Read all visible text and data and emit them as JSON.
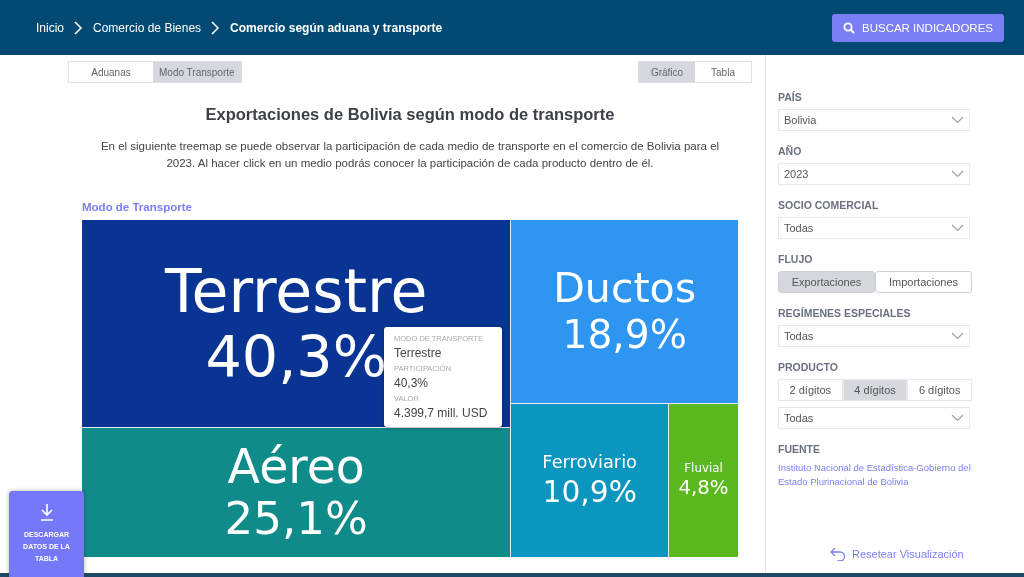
{
  "breadcrumb": [
    {
      "label": "Inicio",
      "current": false
    },
    {
      "label": "Comercio de Bienes",
      "current": false
    },
    {
      "label": "Comercio según aduana y transporte",
      "current": true
    }
  ],
  "search_button": "BUSCAR INDICADORES",
  "view_tabs": [
    {
      "label": "Aduanas",
      "selected": false
    },
    {
      "label": "Modo Transporte",
      "selected": true
    }
  ],
  "chart_tabs": [
    {
      "label": "Gráfico",
      "selected": true
    },
    {
      "label": "Tabla",
      "selected": false
    }
  ],
  "title": "Exportaciones de Bolivia según modo de transporte",
  "description": "En el siguiente treemap se puede observar la participación de cada medio de transporte en el comercio de Bolivia para el 2023. Al hacer click en un medio  podrás conocer la participación de cada producto dentro de él.",
  "treemap": {
    "heading": "Modo de Transporte",
    "columns": [
      {
        "rows": [
          {
            "tiles": [
              {
                "label": "Terrestre",
                "share": "40,3%",
                "color": "#0a3494"
              }
            ]
          },
          {
            "tiles": [
              {
                "label": "Aéreo",
                "share": "25,1%",
                "color": "#0f8b8a"
              }
            ]
          }
        ]
      },
      {
        "rows": [
          {
            "tiles": [
              {
                "label": "Ductos",
                "share": "18,9%",
                "color": "#2e96f0"
              }
            ]
          },
          {
            "tiles": [
              {
                "label": "Ferroviario",
                "share": "10,9%",
                "color": "#0a96be"
              },
              {
                "label": "Fluvial",
                "share": "4,8%",
                "color": "#5cb81f"
              }
            ]
          }
        ]
      }
    ],
    "tooltip": [
      {
        "label": "MODO DE TRANSPORTE",
        "value": "Terrestre"
      },
      {
        "label": "PARTICIPACIÓN",
        "value": "40,3%"
      },
      {
        "label": "VALOR",
        "value": "4.399,7 mill. USD"
      }
    ]
  },
  "download_button": "DESCARGAR DATOS DE LA TABLA",
  "filters": [
    {
      "kind": "select",
      "label": "PAÍS",
      "value": "Bolivia"
    },
    {
      "kind": "select",
      "label": "AÑO",
      "value": "2023"
    },
    {
      "kind": "select",
      "label": "SOCIO COMERCIAL",
      "value": "Todas"
    },
    {
      "kind": "toggle",
      "label": "FLUJO",
      "options": [
        {
          "label": "Exportaciones",
          "selected": true
        },
        {
          "label": "Importaciones",
          "selected": false
        }
      ]
    },
    {
      "kind": "select",
      "label": "REGÍMENES ESPECIALES",
      "value": "Todas"
    },
    {
      "kind": "toggle",
      "label": "PRODUCTO",
      "options": [
        {
          "label": "2 dígitos",
          "selected": false
        },
        {
          "label": "4 dígitos",
          "selected": true
        },
        {
          "label": "6 dígitos",
          "selected": false
        }
      ]
    },
    {
      "kind": "select",
      "value": "Todas"
    },
    {
      "kind": "source",
      "label": "FUENTE",
      "text": "Instituto Nacional de  Estadística-Gobierno del Estado Plurinacional de Bolivia"
    }
  ],
  "reset_link": "Resetear Visualización"
}
